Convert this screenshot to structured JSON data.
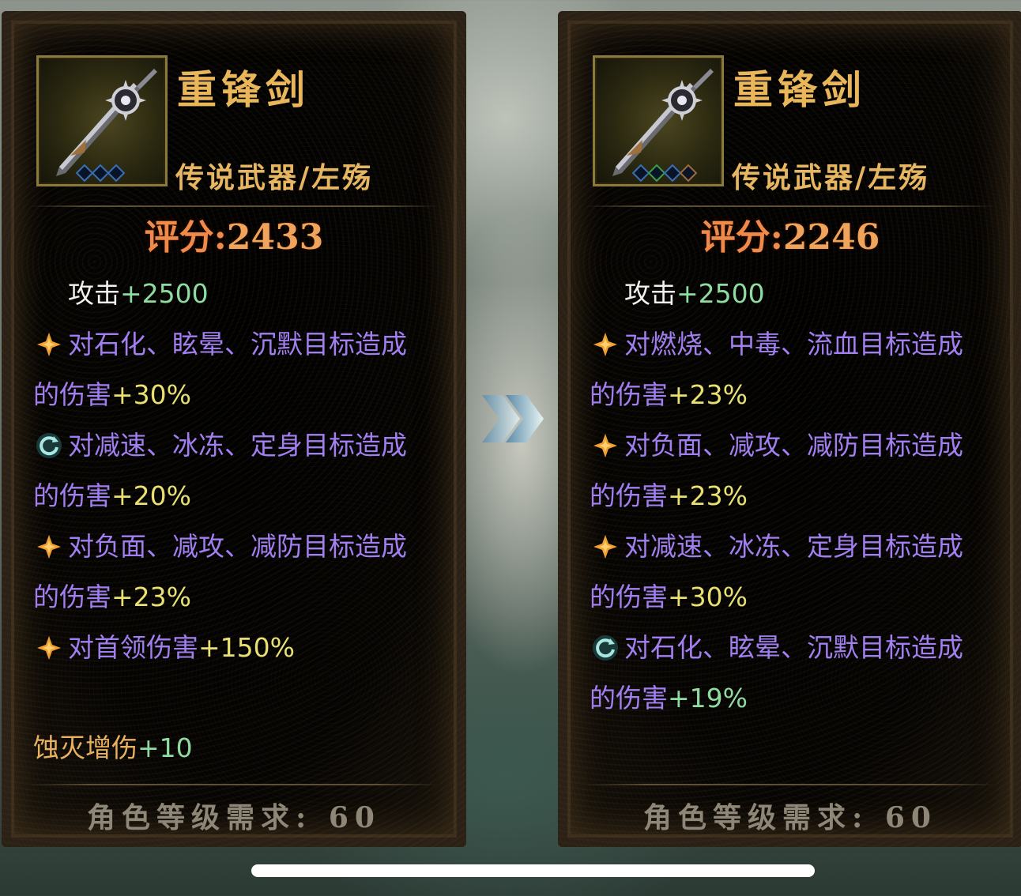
{
  "left_panel": {
    "name": "重锋剑",
    "type": "传说武器/左殇",
    "score_label": "评分:",
    "score_value": "2433",
    "base_stat": {
      "label": "攻击",
      "value": "+2500"
    },
    "affixes": [
      {
        "icon": "orange-star-icon",
        "line1": "对石化、眩晕、沉默目标造成",
        "line2": "的伤害",
        "value": "+30%"
      },
      {
        "icon": "cyan-refresh-icon",
        "line1": "对减速、冰冻、定身目标造成",
        "line2": "的伤害",
        "value": "+20%"
      },
      {
        "icon": "orange-star-icon",
        "line1": "对负面、减攻、减防目标造成",
        "line2": "的伤害",
        "value": "+23%"
      },
      {
        "icon": "orange-star-icon",
        "line1": "对首领伤害",
        "value": "+150%"
      }
    ],
    "special": {
      "label": "蚀灭增伤",
      "value": "+10"
    },
    "requirement": "角色等级需求: 60"
  },
  "right_panel": {
    "name": "重锋剑",
    "type": "传说武器/左殇",
    "score_label": "评分:",
    "score_value": "2246",
    "base_stat": {
      "label": "攻击",
      "value": "+2500"
    },
    "affixes": [
      {
        "icon": "orange-star-icon",
        "line1": "对燃烧、中毒、流血目标造成",
        "line2": "的伤害",
        "value": "+23%"
      },
      {
        "icon": "orange-star-icon",
        "line1": "对负面、减攻、减防目标造成",
        "line2": "的伤害",
        "value": "+23%"
      },
      {
        "icon": "orange-star-icon",
        "line1": "对减速、冰冻、定身目标造成",
        "line2": "的伤害",
        "value": "+30%"
      },
      {
        "icon": "cyan-refresh-icon",
        "line1": "对石化、眩晕、沉默目标造成",
        "line2": "的伤害",
        "value": "+19%"
      }
    ],
    "requirement": "角色等级需求: 60"
  },
  "colors": {
    "name_gold": "#e9b65a",
    "score_orange": "#f08a4a",
    "affix_purple": "#a27ff0",
    "value_yellow": "#e8e070",
    "value_green": "#8fdca0"
  }
}
